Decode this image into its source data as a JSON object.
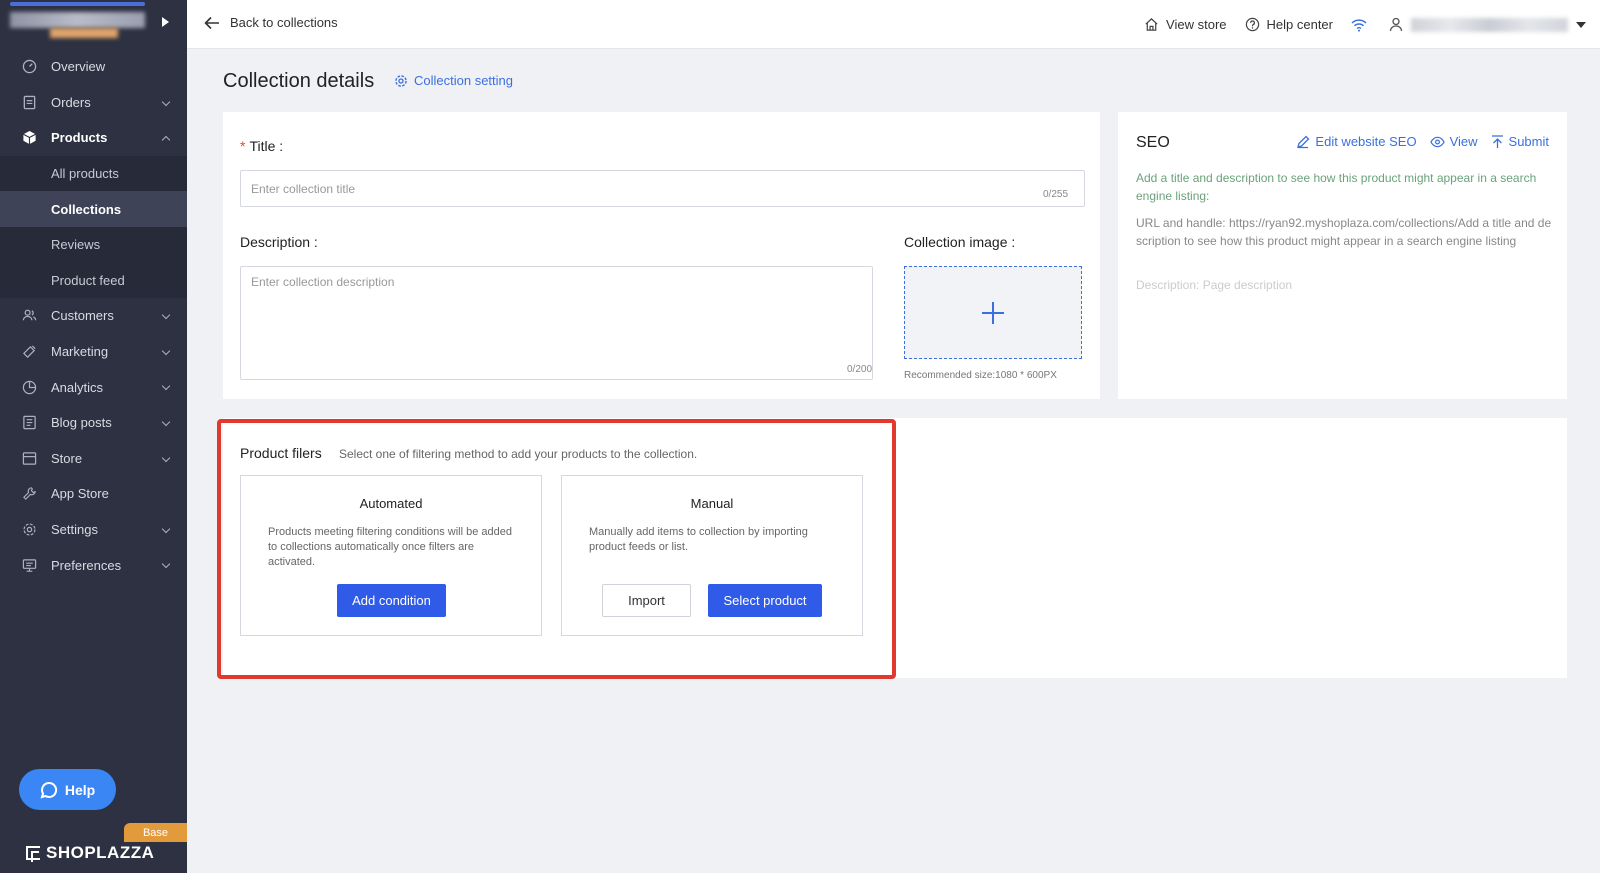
{
  "sidebar": {
    "items": [
      {
        "label": "Overview"
      },
      {
        "label": "Orders"
      },
      {
        "label": "Products"
      },
      {
        "label": "Customers"
      },
      {
        "label": "Marketing"
      },
      {
        "label": "Analytics"
      },
      {
        "label": "Blog posts"
      },
      {
        "label": "Store"
      },
      {
        "label": "App Store"
      },
      {
        "label": "Settings"
      },
      {
        "label": "Preferences"
      }
    ],
    "product_sub": [
      {
        "label": "All products"
      },
      {
        "label": "Collections"
      },
      {
        "label": "Reviews"
      },
      {
        "label": "Product feed"
      }
    ],
    "help_label": "Help",
    "base_badge": "Base",
    "logo_text": "SHOPLAZZA"
  },
  "topbar": {
    "back_label": "Back to collections",
    "view_store": "View store",
    "help_center": "Help center"
  },
  "page": {
    "title": "Collection details",
    "collection_setting": "Collection setting"
  },
  "form": {
    "title_label": "Title",
    "title_placeholder": "Enter collection title",
    "title_count": "0/255",
    "desc_label": "Description",
    "desc_placeholder": "Enter collection description",
    "desc_count": "0/200",
    "image_label": "Collection image",
    "image_hint": "Recommended size:1080 * 600PX"
  },
  "seo": {
    "title": "SEO",
    "edit_label": "Edit website SEO",
    "view_label": "View",
    "submit_label": "Submit",
    "hint": "Add a title and description to see how this product might appear in a search engine listing:",
    "url_text": "URL and handle: https://ryan92.myshoplaza.com/collections/Add a title and description to see how this product might appear in a search engine listing",
    "desc_text": "Description: Page description"
  },
  "filters": {
    "title": "Product filers",
    "subtitle": "Select one of filtering method to add your products to the collection.",
    "automated": {
      "title": "Automated",
      "text": "Products meeting filtering conditions will be added to collections automatically once filters are activated.",
      "button": "Add condition"
    },
    "manual": {
      "title": "Manual",
      "text": "Manually add items to collection by importing product feeds or list.",
      "import_button": "Import",
      "select_button": "Select product"
    }
  },
  "colors": {
    "sidebar_bg": "#2d3142",
    "primary": "#2f5be8",
    "link": "#3b6fe0",
    "highlight": "#e03a2f",
    "help_button": "#3a86f4"
  }
}
